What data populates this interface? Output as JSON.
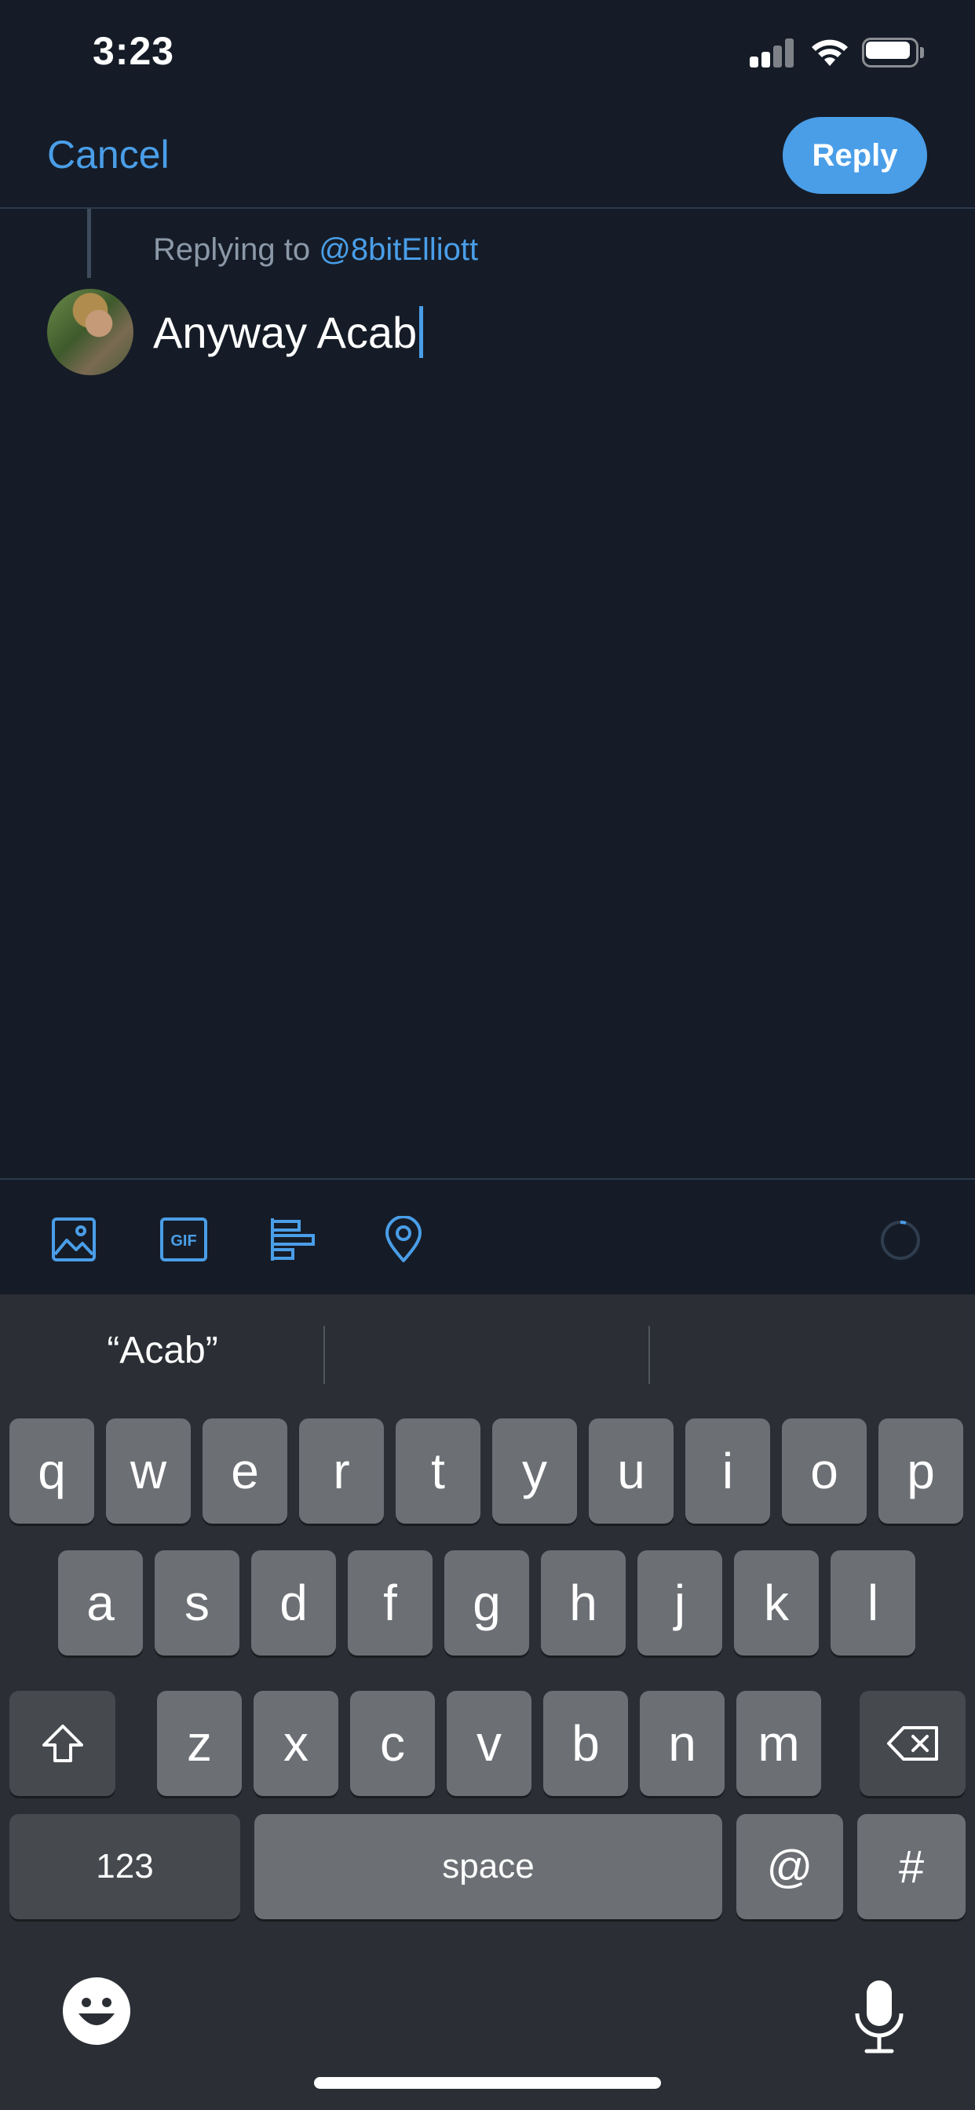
{
  "status_bar": {
    "time": "3:23",
    "signal_icon": "cellular-signal-icon",
    "wifi_icon": "wifi-icon",
    "battery_icon": "battery-icon"
  },
  "nav": {
    "cancel_label": "Cancel",
    "reply_label": "Reply"
  },
  "compose": {
    "replying_prefix": "Replying to ",
    "replying_handle": "@8bitElliott",
    "text": "Anyway Acab"
  },
  "toolbar": {
    "icons": [
      "image-icon",
      "gif-icon",
      "poll-icon",
      "location-icon",
      "character-counter-icon"
    ],
    "gif_label": "GIF"
  },
  "keyboard": {
    "predictions": [
      "“Acab”",
      "",
      ""
    ],
    "row1": [
      "q",
      "w",
      "e",
      "r",
      "t",
      "y",
      "u",
      "i",
      "o",
      "p"
    ],
    "row2": [
      "a",
      "s",
      "d",
      "f",
      "g",
      "h",
      "j",
      "k",
      "l"
    ],
    "row3": [
      "z",
      "x",
      "c",
      "v",
      "b",
      "n",
      "m"
    ],
    "numbers_label": "123",
    "space_label": "space",
    "at_label": "@",
    "hash_label": "#"
  },
  "colors": {
    "background": "#151c27",
    "accent": "#4a9ee8",
    "muted_text": "#8b98a8",
    "keyboard_bg": "#2b2f35",
    "key": "#6c6f74",
    "key_dark": "#46494e"
  }
}
